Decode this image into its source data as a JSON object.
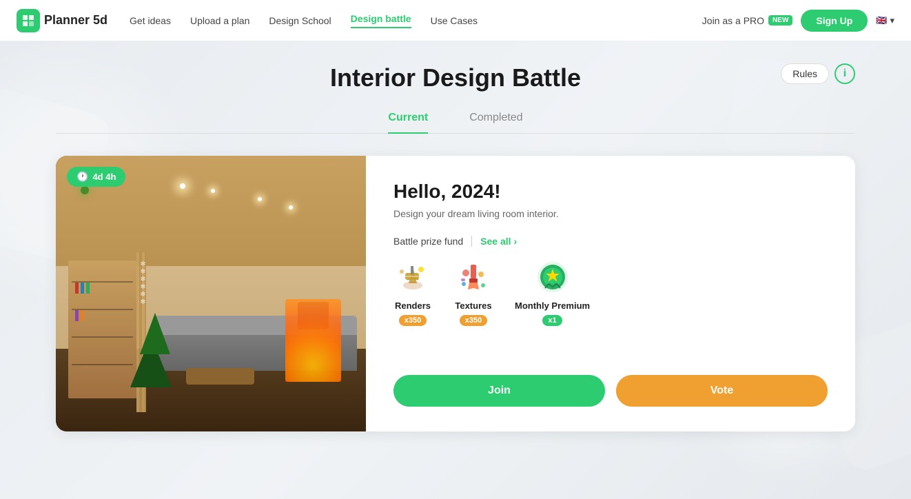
{
  "nav": {
    "logo_text": "Planner",
    "logo_num": "5d",
    "links": [
      {
        "label": "Get ideas",
        "active": false
      },
      {
        "label": "Upload a plan",
        "active": false
      },
      {
        "label": "Design School",
        "active": false
      },
      {
        "label": "Design battle",
        "active": true
      },
      {
        "label": "Use Cases",
        "active": false
      }
    ],
    "pro_label": "Join as a PRO",
    "new_badge": "NEW",
    "signup_label": "Sign Up",
    "lang": "EN"
  },
  "page": {
    "title": "Interior Design Battle",
    "rules_label": "Rules",
    "info_icon": "i"
  },
  "tabs": [
    {
      "label": "Current",
      "active": true
    },
    {
      "label": "Completed",
      "active": false
    }
  ],
  "battle": {
    "timer": "4d 4h",
    "title": "Hello, 2024!",
    "description": "Design your dream living room interior.",
    "prize_label": "Battle prize fund",
    "see_all_label": "See all",
    "prizes": [
      {
        "name": "Renders",
        "count": "x350",
        "count_color": "orange",
        "icon": "renders"
      },
      {
        "name": "Textures",
        "count": "x350",
        "count_color": "orange",
        "icon": "textures"
      },
      {
        "name": "Monthly Premium",
        "count": "x1",
        "count_color": "green",
        "icon": "premium"
      }
    ],
    "join_label": "Join",
    "vote_label": "Vote"
  }
}
